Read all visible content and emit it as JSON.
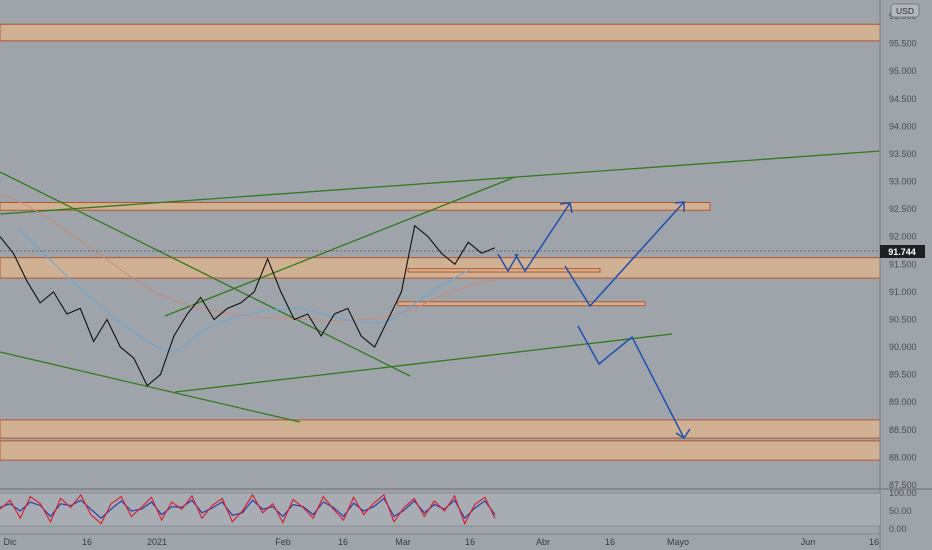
{
  "colors": {
    "background": "#9fa3aa",
    "zone_fill": "#d9b48f",
    "zone_edge": "#b5562f",
    "trendline": "#2f7a1c",
    "arrow": "#1f4fb5",
    "candle": "#111111",
    "ma_slow": "#c98b7f",
    "ma_fast": "#6aa6d8",
    "stoch_k": "#d8242f",
    "stoch_d": "#2b3ea8",
    "price_tag": "#1d1f22"
  },
  "header": {
    "currency": "USD",
    "current_price": "91.744"
  },
  "chart_data": {
    "type": "line",
    "title": "",
    "xlabel": "",
    "ylabel": "",
    "ylim": [
      87.5,
      96.1
    ],
    "y_ticks": [
      "96.000",
      "95.500",
      "95.000",
      "94.500",
      "94.000",
      "93.500",
      "93.000",
      "92.500",
      "92.000",
      "91.500",
      "91.000",
      "90.500",
      "90.000",
      "89.500",
      "89.000",
      "88.500",
      "88.000",
      "87.500"
    ],
    "x_ticks": [
      "Dic",
      "16",
      "2021",
      "Feb",
      "16",
      "Mar",
      "16",
      "Abr",
      "16",
      "Mayo",
      "Jun",
      "16"
    ],
    "grid": false,
    "series": [
      {
        "x": [
          0,
          3,
          6,
          9,
          12,
          15,
          18,
          21,
          24,
          27,
          30,
          33,
          36,
          39,
          42,
          45,
          48,
          51,
          54,
          57,
          60,
          63,
          66,
          69,
          72,
          75,
          78,
          81,
          84,
          87,
          90,
          93,
          96,
          99,
          102,
          105,
          108,
          111
        ],
        "values": [
          92.0,
          91.7,
          91.2,
          90.8,
          91.0,
          90.6,
          90.7,
          90.1,
          90.5,
          90.0,
          89.8,
          89.3,
          89.5,
          90.2,
          90.6,
          90.9,
          90.5,
          90.7,
          90.8,
          91.0,
          91.6,
          91.0,
          90.5,
          90.6,
          90.2,
          90.6,
          90.7,
          90.2,
          90.0,
          90.5,
          91.0,
          92.2,
          92.0,
          91.7,
          91.5,
          91.9,
          91.7,
          91.8
        ]
      }
    ],
    "zones": [
      {
        "low": 95.55,
        "high": 95.85
      },
      {
        "low": 92.48,
        "high": 92.62
      },
      {
        "low": 91.25,
        "high": 91.62
      },
      {
        "low": 91.36,
        "high": 91.42
      },
      {
        "low": 90.75,
        "high": 90.82
      },
      {
        "low": 88.35,
        "high": 88.68
      },
      {
        "low": 87.95,
        "high": 88.3
      }
    ],
    "stochastic": {
      "y_ticks": [
        "100.00",
        "50.00",
        "0.00"
      ],
      "k": [
        55,
        80,
        30,
        90,
        70,
        20,
        85,
        60,
        95,
        40,
        15,
        70,
        90,
        35,
        60,
        88,
        25,
        75,
        55,
        92,
        30,
        65,
        85,
        20,
        50,
        95,
        45,
        70,
        18,
        82,
        60,
        30,
        90,
        55,
        25,
        88,
        40,
        72,
        95,
        20,
        60,
        85,
        35,
        78,
        50,
        92,
        15,
        68,
        88,
        30
      ],
      "d": [
        60,
        70,
        50,
        75,
        65,
        35,
        70,
        65,
        80,
        55,
        30,
        55,
        78,
        50,
        55,
        75,
        40,
        62,
        60,
        80,
        45,
        58,
        75,
        38,
        45,
        80,
        55,
        62,
        35,
        68,
        62,
        40,
        75,
        60,
        35,
        72,
        50,
        62,
        85,
        35,
        52,
        78,
        45,
        68,
        55,
        80,
        30,
        58,
        78,
        40
      ]
    }
  }
}
